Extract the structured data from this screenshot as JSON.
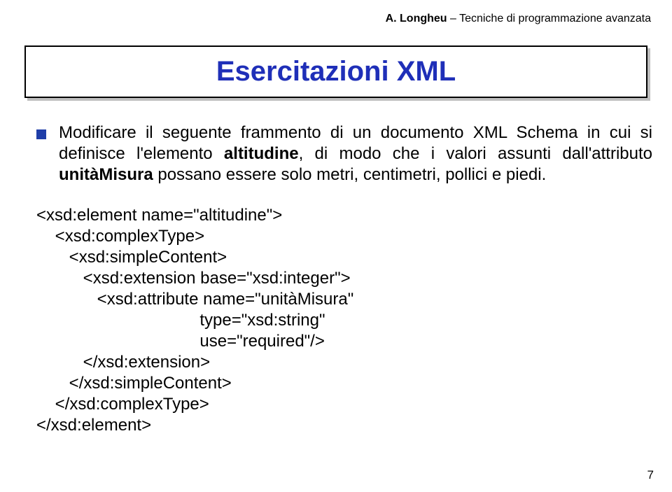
{
  "header": {
    "author": "A. Longheu",
    "rest": " – Tecniche di programmazione avanzata"
  },
  "title": "Esercitazioni XML",
  "paragraph": {
    "p1": "Modificare il seguente frammento di un documento XML Schema in cui si definisce l'elemento ",
    "kw1": "altitudine",
    "p2": ", di modo che i valori assunti dall'attributo ",
    "kw2": "unitàMisura",
    "p3": " possano essere solo metri, centimetri, pollici e piedi."
  },
  "code": {
    "l1": "<xsd:element name=\"altitudine\">",
    "l2": "    <xsd:complexType>",
    "l3": "       <xsd:simpleContent>",
    "l4": "          <xsd:extension base=\"xsd:integer\">",
    "l5": "             <xsd:attribute name=\"unitàMisura\"",
    "l6": "                                   type=\"xsd:string\"",
    "l7": "                                   use=\"required\"/>",
    "l8": "          </xsd:extension>",
    "l9": "       </xsd:simpleContent>",
    "l10": "    </xsd:complexType>",
    "l11": "</xsd:element>"
  },
  "pageNumber": "7"
}
